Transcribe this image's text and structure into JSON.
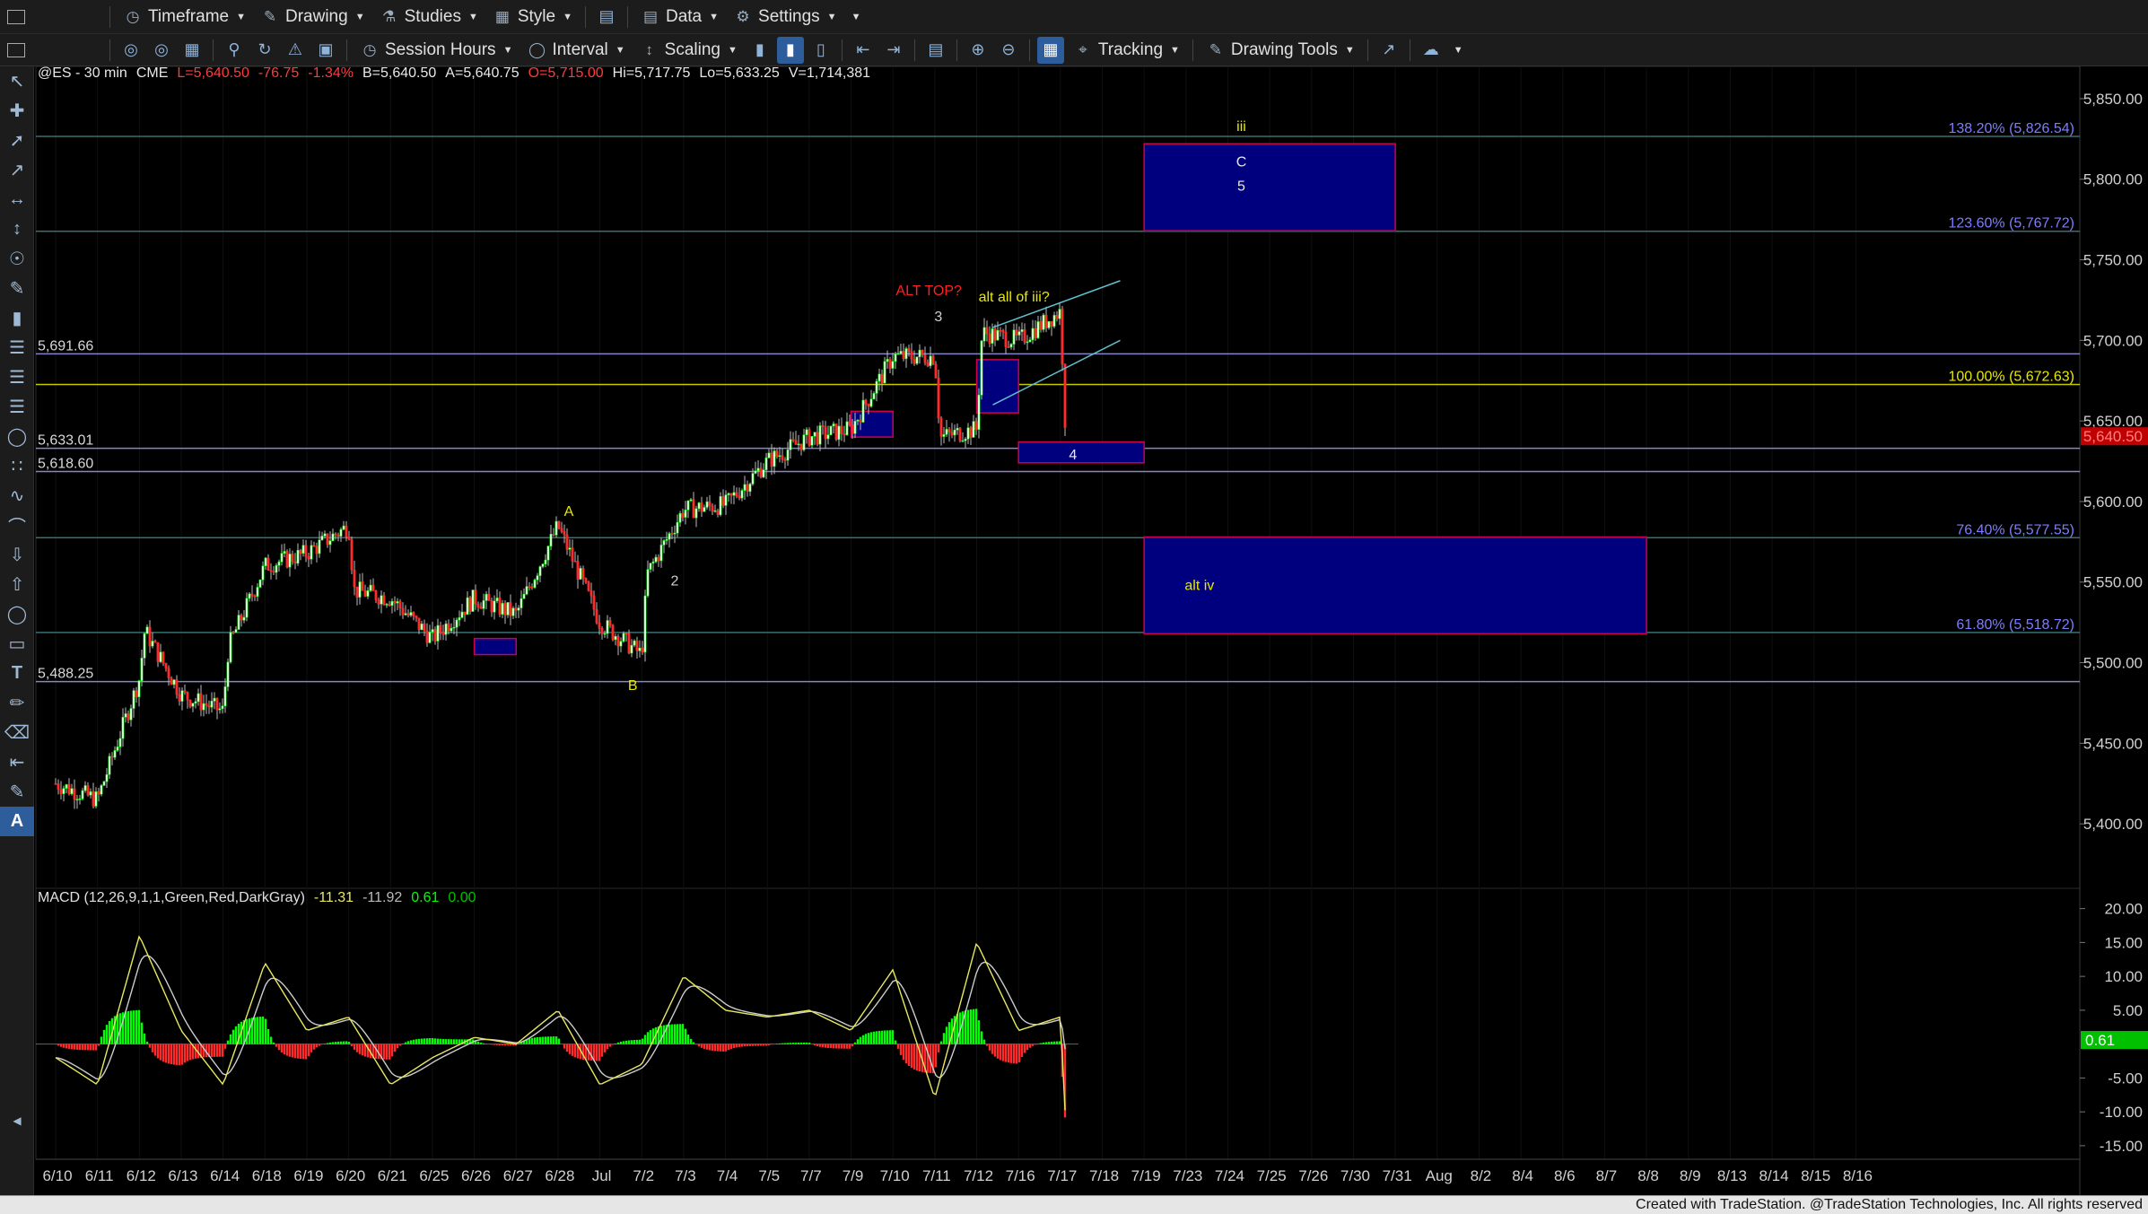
{
  "toolbar1": {
    "timeframe": "Timeframe",
    "drawing": "Drawing",
    "studies": "Studies",
    "style": "Style",
    "data": "Data",
    "settings": "Settings"
  },
  "toolbar2": {
    "session_hours": "Session Hours",
    "interval": "Interval",
    "scaling": "Scaling",
    "tracking": "Tracking",
    "drawing_tools": "Drawing Tools"
  },
  "symbol_bar": {
    "symbol": "@ES - 30 min",
    "exchange": "CME",
    "last": "L=5,640.50",
    "change": "-76.75",
    "change_pct": "-1.34%",
    "bid": "B=5,640.50",
    "ask": "A=5,640.75",
    "open": "O=5,715.00",
    "high": "Hi=5,717.75",
    "low": "Lo=5,633.25",
    "volume": "V=1,714,381"
  },
  "macd_bar": {
    "label": "MACD (12,26,9,1,1,Green,Red,DarkGray)",
    "v1": "-11.31",
    "v2": "-11.92",
    "v3": "0.61",
    "v4": "0.00"
  },
  "footer": {
    "created_with": "Created with TradeStation. @TradeStation Technologies, Inc. All rights reserved"
  },
  "colors": {
    "up": "#00ff00",
    "down": "#ff2b2b",
    "box_fill": "#00007f",
    "box_border": "#d0004e",
    "fib_line": "#3a6f6f",
    "fib_text": "#7d7dff",
    "level_line": "#8585c8",
    "yellow_line": "#c8c800",
    "label_yellow": "#e8e800",
    "label_red": "#ff2020",
    "channel": "#5fc0d0"
  },
  "chart_data": [
    {
      "type": "candlestick",
      "title": "@ES - 30 min",
      "ylim": [
        5360,
        5870
      ],
      "y_ticks": [
        "5,850.00",
        "5,800.00",
        "5,750.00",
        "5,700.00",
        "5,650.00",
        "5,600.00",
        "5,550.00",
        "5,500.00",
        "5,450.00",
        "5,400.00"
      ],
      "y_tick_values": [
        5850,
        5800,
        5750,
        5700,
        5650,
        5600,
        5550,
        5500,
        5450,
        5400
      ],
      "last_price_label": "5,640.50",
      "last_price": 5640.5,
      "x_ticks": [
        "6/10",
        "6/11",
        "6/12",
        "6/13",
        "6/14",
        "6/18",
        "6/19",
        "6/20",
        "6/21",
        "6/25",
        "6/26",
        "6/27",
        "6/28",
        "Jul",
        "7/2",
        "7/3",
        "7/4",
        "7/5",
        "7/7",
        "7/9",
        "7/10",
        "7/11",
        "7/12",
        "7/16",
        "7/17",
        "7/18",
        "7/19",
        "7/23",
        "7/24",
        "7/25",
        "7/26",
        "7/30",
        "7/31",
        "Aug",
        "8/2",
        "8/4",
        "8/6",
        "8/7",
        "8/8",
        "8/9",
        "8/13",
        "8/14",
        "8/15",
        "8/16"
      ],
      "price_path_keypoints": [
        [
          "6/10",
          5425
        ],
        [
          "6/11",
          5415
        ],
        [
          "6/12",
          5490
        ],
        [
          "6/12",
          5520
        ],
        [
          "6/13",
          5480
        ],
        [
          "6/14",
          5470
        ],
        [
          "6/14",
          5510
        ],
        [
          "6/18",
          5560
        ],
        [
          "6/19",
          5568
        ],
        [
          "6/20",
          5585
        ],
        [
          "6/20",
          5545
        ],
        [
          "6/21",
          5540
        ],
        [
          "6/25",
          5515
        ],
        [
          "6/26",
          5540
        ],
        [
          "6/27",
          5530
        ],
        [
          "6/28",
          5585
        ],
        [
          "Jul",
          5525
        ],
        [
          "7/2",
          5505
        ],
        [
          "7/2",
          5555
        ],
        [
          "7/3",
          5595
        ],
        [
          "7/4",
          5598
        ],
        [
          "7/5",
          5625
        ],
        [
          "7/7",
          5640
        ],
        [
          "7/9",
          5645
        ],
        [
          "7/10",
          5690
        ],
        [
          "7/11",
          5690
        ],
        [
          "7/11",
          5640
        ],
        [
          "7/12",
          5645
        ],
        [
          "7/12",
          5705
        ],
        [
          "7/16",
          5700
        ],
        [
          "7/17",
          5718
        ],
        [
          "7/17",
          5640
        ]
      ],
      "horizontal_levels": [
        {
          "label": "5,691.66",
          "value": 5691.66
        },
        {
          "label": "5,633.01",
          "value": 5633.01
        },
        {
          "label": "5,618.60",
          "value": 5618.6
        },
        {
          "label": "5,488.25",
          "value": 5488.25
        }
      ],
      "fib_levels": [
        {
          "label": "138.20% (5,826.54)",
          "value": 5826.54
        },
        {
          "label": "123.60% (5,767.72)",
          "value": 5767.72
        },
        {
          "label": "100.00% (5,672.63)",
          "value": 5672.63
        },
        {
          "label": "76.40% (5,577.55)",
          "value": 5577.55
        },
        {
          "label": "61.80% (5,518.72)",
          "value": 5518.72
        }
      ],
      "target_boxes": [
        {
          "from": "7/19",
          "to": "7/31",
          "top": 5822,
          "bottom": 5768
        },
        {
          "from": "7/19",
          "to": "8/8",
          "top": 5578,
          "bottom": 5518
        },
        {
          "from": "7/16",
          "to": "7/19",
          "top": 5637,
          "bottom": 5624
        },
        {
          "from": "7/9",
          "to": "7/10",
          "top": 5656,
          "bottom": 5640
        },
        {
          "from": "7/12",
          "to": "7/16",
          "top": 5688,
          "bottom": 5655
        },
        {
          "from": "6/26",
          "to": "6/27",
          "top": 5515,
          "bottom": 5505
        }
      ],
      "wave_labels": [
        "iii",
        "C",
        "5",
        "ALT TOP?",
        "alt all of iii?",
        "3",
        "4",
        "A",
        "2",
        "B",
        "alt iv"
      ]
    },
    {
      "type": "histogram+line",
      "title": "MACD (12,26,9,1,1,Green,Red,DarkGray)",
      "ylim": [
        -17,
        23
      ],
      "y_ticks": [
        "20.00",
        "15.00",
        "10.00",
        "5.00",
        "-5.00",
        "-10.00",
        "-15.00"
      ],
      "y_tick_values": [
        20,
        15,
        10,
        5,
        -5,
        -10,
        -15
      ],
      "last_value_label": "0.61",
      "last_value": 0.61,
      "macd_keypoints": [
        [
          "6/10",
          -2
        ],
        [
          "6/11",
          -6
        ],
        [
          "6/12",
          16
        ],
        [
          "6/13",
          2
        ],
        [
          "6/14",
          -6
        ],
        [
          "6/18",
          12
        ],
        [
          "6/19",
          2
        ],
        [
          "6/20",
          4
        ],
        [
          "6/21",
          -6
        ],
        [
          "6/25",
          -2
        ],
        [
          "6/26",
          1
        ],
        [
          "6/27",
          0
        ],
        [
          "6/28",
          5
        ],
        [
          "Jul",
          -6
        ],
        [
          "7/2",
          -3
        ],
        [
          "7/3",
          10
        ],
        [
          "7/4",
          5
        ],
        [
          "7/5",
          4
        ],
        [
          "7/7",
          5
        ],
        [
          "7/9",
          2
        ],
        [
          "7/10",
          11
        ],
        [
          "7/11",
          -8
        ],
        [
          "7/12",
          15
        ],
        [
          "7/16",
          2
        ],
        [
          "7/17",
          4
        ],
        [
          "7/17",
          -12
        ]
      ]
    }
  ]
}
